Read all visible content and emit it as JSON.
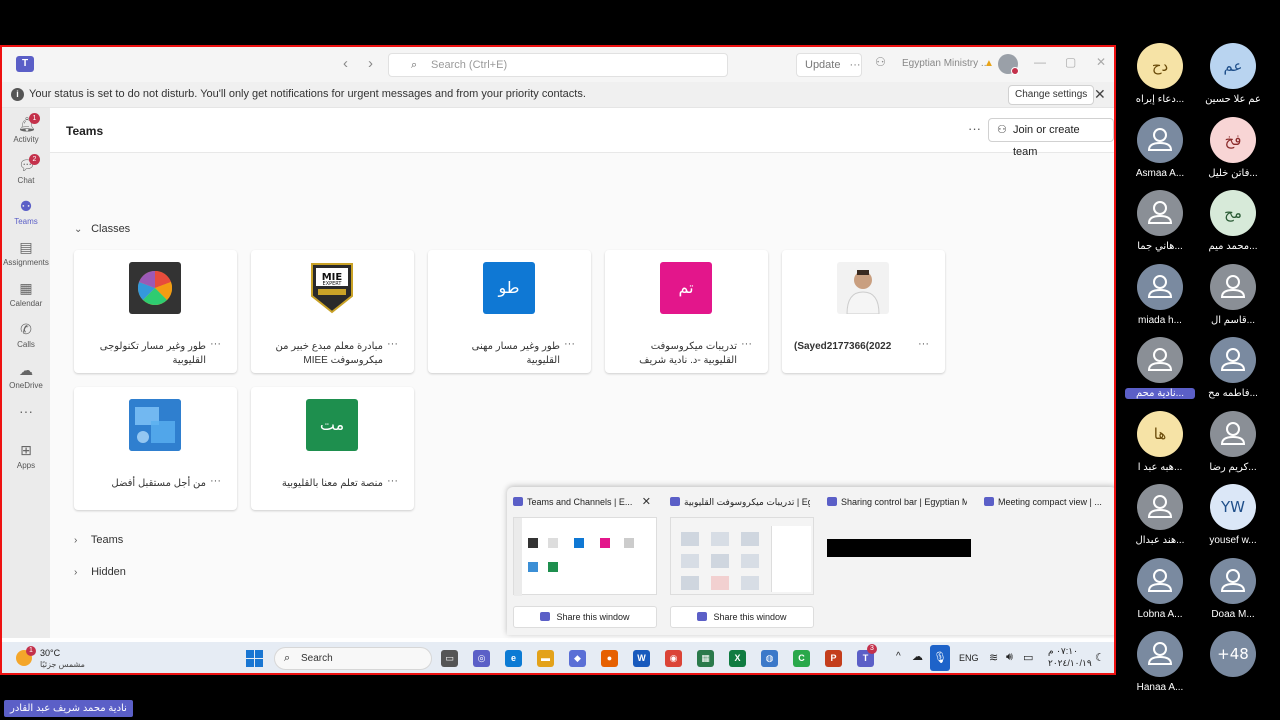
{
  "titlebar": {
    "search_placeholder": "Search (Ctrl+E)",
    "update_label": "Update",
    "org_name": "Egyptian Ministry ..."
  },
  "notice": {
    "message": "Your status is set to do not disturb. You'll only get notifications for urgent messages and from your priority contacts.",
    "change_settings": "Change settings"
  },
  "rail": [
    {
      "label": "Activity",
      "icon": "bell-icon",
      "badge": "1"
    },
    {
      "label": "Chat",
      "icon": "chat-icon",
      "badge": "2"
    },
    {
      "label": "Teams",
      "icon": "teams-icon",
      "badge": ""
    },
    {
      "label": "Assignments",
      "icon": "assignments-icon",
      "badge": ""
    },
    {
      "label": "Calendar",
      "icon": "calendar-icon",
      "badge": ""
    },
    {
      "label": "Calls",
      "icon": "phone-icon",
      "badge": ""
    },
    {
      "label": "OneDrive",
      "icon": "cloud-icon",
      "badge": ""
    },
    {
      "label": "",
      "icon": "more-icon",
      "badge": ""
    },
    {
      "label": "Apps",
      "icon": "apps-icon",
      "badge": ""
    }
  ],
  "main": {
    "title": "Teams",
    "join_label": "Join or create team",
    "sections": {
      "classes": "Classes",
      "teams": "Teams",
      "hidden": "Hidden"
    },
    "cards": [
      {
        "name": "طور وغير مسار تكنولوجى القليوبية",
        "tile_text": "",
        "tile_color": "#333333",
        "tile_kind": "wheel"
      },
      {
        "name": "مبادرة معلم مبدع خبير من ميكروسوفت MIEE",
        "tile_text": "MIE EXPERT",
        "tile_color": "#2a2a2a",
        "tile_kind": "badge"
      },
      {
        "name": "طور وغير مسار مهنى القليوبية",
        "tile_text": "طو",
        "tile_color": "#0f78d4",
        "tile_kind": "text"
      },
      {
        "name": "تدريبات ميكروسوفت القليوبية -د. نادية شريف",
        "tile_text": "تم",
        "tile_color": "#e3168b",
        "tile_kind": "text"
      },
      {
        "name": "(Sayed2177366(2022",
        "tile_text": "",
        "tile_color": "#d9c7b8",
        "tile_kind": "photo"
      },
      {
        "name": "من أجل مستقبل أفضل",
        "tile_text": "",
        "tile_color": "#3b8fd6",
        "tile_kind": "image"
      },
      {
        "name": "منصة تعلم معنا بالقليوبية",
        "tile_text": "مت",
        "tile_color": "#1e8f4e",
        "tile_kind": "text"
      }
    ]
  },
  "preview": [
    {
      "title": "Teams and Channels | E...",
      "share": "Share this window",
      "closable": true
    },
    {
      "title": "تدريبات ميكروسوفت القليوبية | Egyptian...",
      "share": "Share this window",
      "closable": false
    },
    {
      "title": "Sharing control bar | Egyptian Mi...",
      "share": "",
      "closable": false
    },
    {
      "title": "Meeting compact view | ...",
      "share": "",
      "closable": false
    }
  ],
  "taskbar": {
    "weather_temp": "30°C",
    "weather_cond": "مشمس جزئيًا",
    "weather_badge": "1",
    "search_label": "Search",
    "lang": "ENG",
    "time": "٠٧:١٠ م",
    "date": "٢٠٢٤/١٠/١٩",
    "teams_badge": "3"
  },
  "participants": [
    {
      "name": "عم علا حسين",
      "initials": "عم",
      "color": "#b9d4f0",
      "fg": "#1f4f8a"
    },
    {
      "name": "دعاء إبراه...",
      "initials": "دح",
      "color": "#f6e3a6",
      "fg": "#6a4b0a"
    },
    {
      "name": "فاتن خليل...",
      "initials": "فخ",
      "color": "#f8d5d5",
      "fg": "#8a2a2a"
    },
    {
      "name": "Asmaa A...",
      "initials": "",
      "color": "#7a8aa0",
      "fg": "#fff"
    },
    {
      "name": "محمد ميم...",
      "initials": "مح",
      "color": "#d7ead9",
      "fg": "#2a5a34"
    },
    {
      "name": "هاني جما...",
      "initials": "",
      "color": "#8a8f96",
      "fg": "#fff"
    },
    {
      "name": "قاسم ال...",
      "initials": "",
      "color": "#8a8f96",
      "fg": "#fff"
    },
    {
      "name": "miada h...",
      "initials": "",
      "color": "#7a8aa0",
      "fg": "#fff"
    },
    {
      "name": "فاطمه مح...",
      "initials": "",
      "color": "#7a8aa0",
      "fg": "#fff"
    },
    {
      "name": "نادية محم...",
      "initials": "",
      "color": "#8a8f96",
      "fg": "#fff"
    },
    {
      "name": "كريم رضا...",
      "initials": "",
      "color": "#8a8f96",
      "fg": "#fff"
    },
    {
      "name": "هبه عبد ا...",
      "initials": "ها",
      "color": "#f6e3a6",
      "fg": "#6a4b0a"
    },
    {
      "name": "yousef w...",
      "initials": "YW",
      "color": "#dbe7f7",
      "fg": "#1f4f8a"
    },
    {
      "name": "هند عبدال...",
      "initials": "",
      "color": "#8a8f96",
      "fg": "#fff"
    },
    {
      "name": "Doaa M...",
      "initials": "",
      "color": "#7a8aa0",
      "fg": "#fff"
    },
    {
      "name": "Lobna A...",
      "initials": "",
      "color": "#7a8aa0",
      "fg": "#fff"
    },
    {
      "name": "",
      "initials": "+48",
      "color": "#7a8aa0",
      "fg": "#fff"
    },
    {
      "name": "Hanaa A...",
      "initials": "",
      "color": "#7a8aa0",
      "fg": "#fff"
    }
  ],
  "self_label": "نادية محمد شريف عبد القادر"
}
